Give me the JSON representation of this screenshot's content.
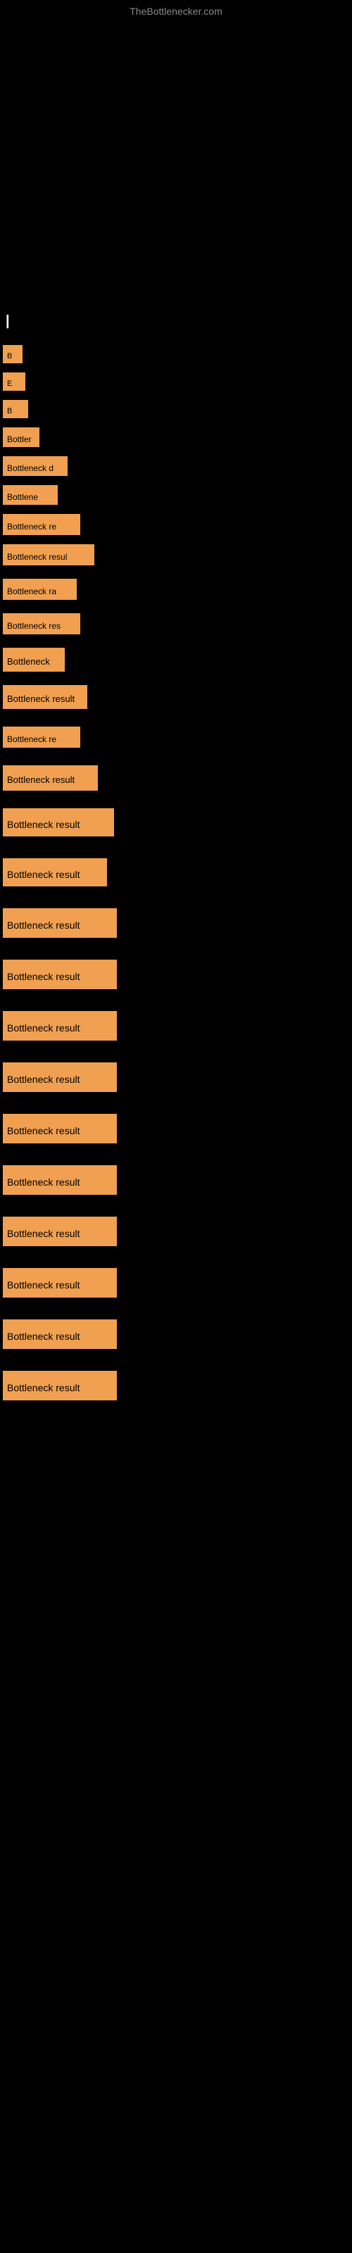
{
  "site": {
    "title": "TheBottlenecker.com"
  },
  "items": [
    {
      "id": 1,
      "label": "B",
      "size": "xs",
      "spacing": "sm"
    },
    {
      "id": 2,
      "label": "E",
      "size": "sm",
      "spacing": "sm"
    },
    {
      "id": 3,
      "label": "B",
      "size": "sm2",
      "spacing": "sm"
    },
    {
      "id": 4,
      "label": "Bottler",
      "size": "md1",
      "spacing": "sm"
    },
    {
      "id": 5,
      "label": "Bottleneck d",
      "size": "md2",
      "spacing": "sm"
    },
    {
      "id": 6,
      "label": "Bottlene",
      "size": "md3",
      "spacing": "sm"
    },
    {
      "id": 7,
      "label": "Bottleneck re",
      "size": "md4",
      "spacing": "sm"
    },
    {
      "id": 8,
      "label": "Bottleneck resul",
      "size": "md5",
      "spacing": "md"
    },
    {
      "id": 9,
      "label": "Bottleneck ra",
      "size": "md6",
      "spacing": "md"
    },
    {
      "id": 10,
      "label": "Bottleneck res",
      "size": "md4",
      "spacing": "md"
    },
    {
      "id": 11,
      "label": "Bottleneck",
      "size": "lg2",
      "spacing": "md"
    },
    {
      "id": 12,
      "label": "Bottleneck result",
      "size": "lg1",
      "spacing": "lg"
    },
    {
      "id": 13,
      "label": "Bottleneck re",
      "size": "md4",
      "spacing": "lg"
    },
    {
      "id": 14,
      "label": "Bottleneck result",
      "size": "lg3",
      "spacing": "lg"
    },
    {
      "id": 15,
      "label": "Bottleneck result",
      "size": "xl",
      "spacing": "xl"
    },
    {
      "id": 16,
      "label": "Bottleneck result",
      "size": "xl2",
      "spacing": "xl"
    },
    {
      "id": 17,
      "label": "Bottleneck result",
      "size": "xl3",
      "spacing": "xl"
    },
    {
      "id": 18,
      "label": "Bottleneck result",
      "size": "xl3",
      "spacing": "xl"
    },
    {
      "id": 19,
      "label": "Bottleneck result",
      "size": "xl3",
      "spacing": "xl"
    },
    {
      "id": 20,
      "label": "Bottleneck result",
      "size": "xl3",
      "spacing": "xl"
    },
    {
      "id": 21,
      "label": "Bottleneck result",
      "size": "xl3",
      "spacing": "xl"
    },
    {
      "id": 22,
      "label": "Bottleneck result",
      "size": "xl3",
      "spacing": "xl"
    },
    {
      "id": 23,
      "label": "Bottleneck result",
      "size": "xl3",
      "spacing": "xl"
    },
    {
      "id": 24,
      "label": "Bottleneck result",
      "size": "xl3",
      "spacing": "xl"
    },
    {
      "id": 25,
      "label": "Bottleneck result",
      "size": "xl3",
      "spacing": "xl"
    },
    {
      "id": 26,
      "label": "Bottleneck result",
      "size": "xl3",
      "spacing": "xl"
    }
  ]
}
